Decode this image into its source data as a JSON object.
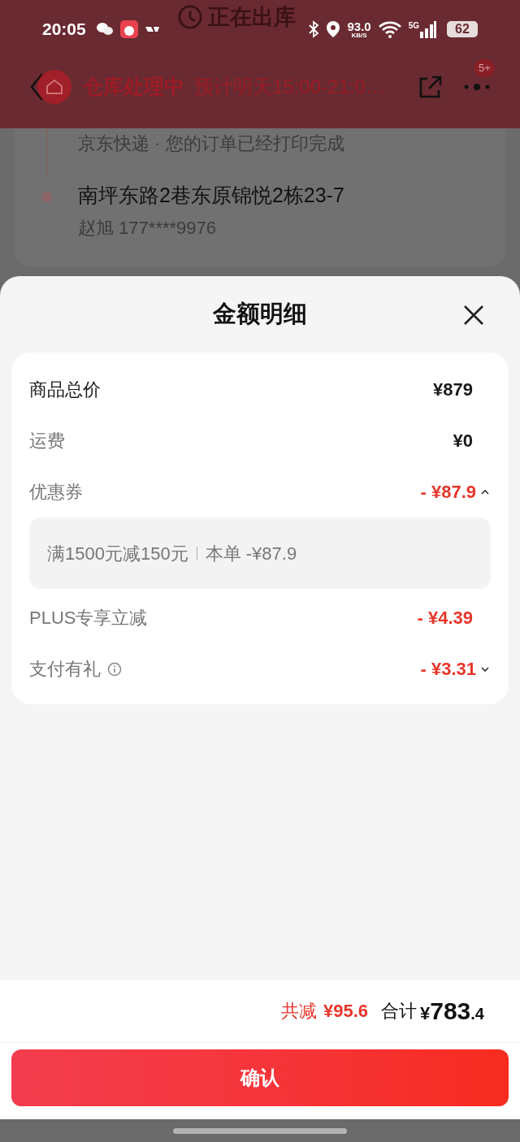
{
  "status_bar": {
    "time": "20:05",
    "speed": "93.0",
    "speed_unit": "KB/S",
    "network": "5G",
    "battery": "62"
  },
  "background_page": {
    "title": "正在出库",
    "status": "仓库处理中",
    "eta": "预计明天15:00-21:0…",
    "badge": "5+",
    "tracking": "京东快递 · 您的订单已经打印完成",
    "address": "南坪东路2巷东原锦悦2栋23-7",
    "contact": "赵旭 177****9976"
  },
  "sheet": {
    "title": "金额明细",
    "rows": [
      {
        "kind": "total",
        "label": "商品总价",
        "amount": "¥879"
      },
      {
        "kind": "fee",
        "label": "运费",
        "amount": "¥0"
      },
      {
        "kind": "discount",
        "label": "优惠券",
        "amount": "- ¥87.9",
        "expanded": true,
        "detail": {
          "rule": "满1500元减150元",
          "applied": "本单 -¥87.9"
        }
      },
      {
        "kind": "discount",
        "label": "PLUS专享立减",
        "amount": "- ¥4.39"
      },
      {
        "kind": "discount",
        "label": "支付有礼",
        "amount": "- ¥3.31",
        "expanded": false,
        "info": true
      }
    ]
  },
  "footer": {
    "saving_label": "共减",
    "saving": "¥95.6",
    "total_label": "合计",
    "total_currency": "¥",
    "total_integer": "783",
    "total_decimal": ".4"
  },
  "confirm_button": "确认"
}
